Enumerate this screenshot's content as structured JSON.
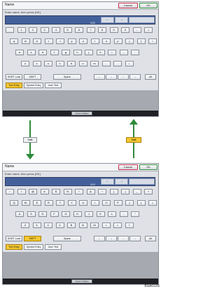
{
  "top_screen": {
    "title": "Name",
    "cancel_label": "Cancel",
    "ok_label": "OK",
    "prompt": "Enter name, then press [OK].",
    "counter": "0/20",
    "left_arrow": "←",
    "right_arrow": "→",
    "row1": [
      "`",
      "1",
      "2",
      "3",
      "4",
      "5",
      "6",
      "7",
      "8",
      "9",
      "0",
      "-",
      "="
    ],
    "row2": [
      "q",
      "w",
      "e",
      "r",
      "t",
      "y",
      "u",
      "i",
      "o",
      "p",
      "[",
      "]",
      "\\"
    ],
    "row3": [
      "a",
      "s",
      "d",
      "f",
      "g",
      "h",
      "j",
      "k",
      "l",
      ";",
      "'"
    ],
    "row4": [
      "z",
      "x",
      "c",
      "v",
      "b",
      "n",
      "m",
      ",",
      ".",
      "/"
    ],
    "func": {
      "shift_lock": "SHIFT Lock",
      "shift": "SHIFT",
      "space": "Space",
      "alt": "Alt"
    },
    "mode_keys": [
      "←",
      "→",
      "↑",
      "↓"
    ],
    "tabs": [
      "Text Entry",
      "Symbol Entry",
      "User Text"
    ],
    "system_status": "System Status"
  },
  "arrows": {
    "down_label": "Shift",
    "up_label": "Shift"
  },
  "bottom_screen": {
    "title": "Name",
    "cancel_label": "Cancel",
    "ok_label": "OK",
    "prompt": "Enter name, then press [OK].",
    "counter": "0/20",
    "left_arrow": "←",
    "right_arrow": "→",
    "row1": [
      "~",
      "!",
      "@",
      "#",
      "$",
      "%",
      "^",
      "&",
      "*",
      "(",
      ")",
      "_",
      "+"
    ],
    "row2": [
      "Q",
      "W",
      "E",
      "R",
      "T",
      "Y",
      "U",
      "I",
      "O",
      "P",
      "{",
      "}",
      "|"
    ],
    "row3": [
      "A",
      "S",
      "D",
      "F",
      "G",
      "H",
      "J",
      "K",
      "L",
      ":",
      "\""
    ],
    "row4": [
      "Z",
      "X",
      "C",
      "V",
      "B",
      "N",
      "M",
      "<",
      ">",
      "?"
    ],
    "func": {
      "shift_lock": "SHIFT Lock",
      "shift": "SHIFT",
      "space": "Space",
      "alt": "Alt"
    },
    "mode_keys": [
      "←",
      "→",
      "↑",
      "↓"
    ],
    "tabs": [
      "Text Entry",
      "Symbol Entry",
      "User Text"
    ],
    "system_status": "System Status"
  },
  "figure_id": "BSA019S",
  "colors": {
    "accent_ok": "#2f8f3c",
    "accent_cancel": "#c7304f",
    "active_key": "#f6c830",
    "input_bg": "#44609b"
  }
}
